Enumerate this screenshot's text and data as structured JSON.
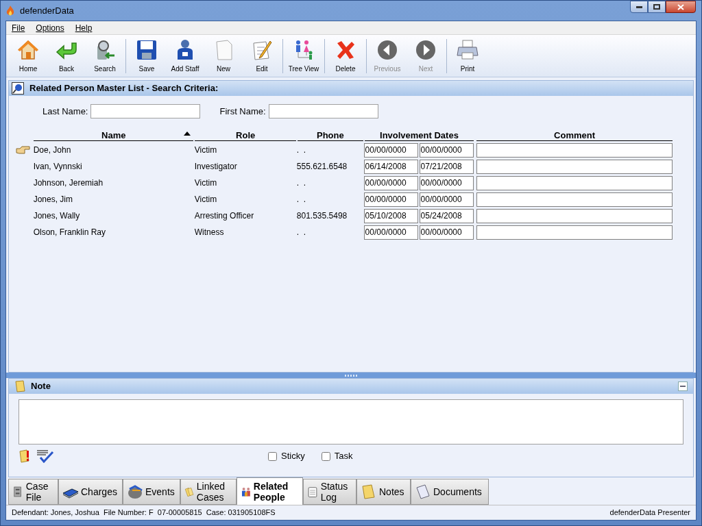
{
  "window": {
    "title": "defenderData"
  },
  "menu": [
    {
      "label": "File"
    },
    {
      "label": "Options"
    },
    {
      "label": "Help"
    }
  ],
  "toolbar": {
    "groups": [
      [
        {
          "label": "Home",
          "disabled": false
        },
        {
          "label": "Back",
          "disabled": false
        },
        {
          "label": "Search",
          "disabled": false
        }
      ],
      [
        {
          "label": "Save",
          "disabled": false
        },
        {
          "label": "Add Staff",
          "disabled": false
        },
        {
          "label": "New",
          "disabled": false
        },
        {
          "label": "Edit",
          "disabled": false
        }
      ],
      [
        {
          "label": "Tree View",
          "disabled": false
        }
      ],
      [
        {
          "label": "Delete",
          "disabled": false
        }
      ],
      [
        {
          "label": "Previous",
          "disabled": true
        },
        {
          "label": "Next",
          "disabled": true
        }
      ],
      [
        {
          "label": "Print",
          "disabled": false
        }
      ]
    ]
  },
  "search_panel": {
    "title": "Related Person Master List - Search Criteria:",
    "fields": [
      {
        "label": "Last Name:"
      },
      {
        "label": "First Name:"
      }
    ]
  },
  "table": {
    "columns": [
      {
        "label": "Name",
        "sorted": true
      },
      {
        "label": "Role",
        "sorted": false
      },
      {
        "label": "Phone",
        "sorted": false
      },
      {
        "label": "Involvement Dates",
        "sorted": false
      },
      {
        "label": "Comment",
        "sorted": false
      }
    ],
    "rows": [
      {
        "current": true,
        "name": "Doe, John",
        "role": "Victim",
        "phone": ".  .",
        "start": "00/00/0000",
        "end": "00/00/0000"
      },
      {
        "current": false,
        "name": "Ivan, Vynnski",
        "role": "Investigator",
        "phone": "555.621.6548",
        "start": "06/14/2008",
        "end": "07/21/2008"
      },
      {
        "current": false,
        "name": "Johnson, Jeremiah",
        "role": "Victim",
        "phone": ".  .",
        "start": "00/00/0000",
        "end": "00/00/0000"
      },
      {
        "current": false,
        "name": "Jones, Jim",
        "role": "Victim",
        "phone": ".  .",
        "start": "00/00/0000",
        "end": "00/00/0000"
      },
      {
        "current": false,
        "name": "Jones, Wally",
        "role": "Arresting Officer",
        "phone": "801.535.5498",
        "start": "05/10/2008",
        "end": "05/24/2008"
      },
      {
        "current": false,
        "name": "Olson, Franklin Ray",
        "role": "Witness",
        "phone": ".  .",
        "start": "00/00/0000",
        "end": "00/00/0000"
      }
    ]
  },
  "note_panel": {
    "title": "Note",
    "options": [
      {
        "label": "Sticky",
        "checked": false
      },
      {
        "label": "Task",
        "checked": false
      }
    ]
  },
  "tabs": [
    {
      "label": "Case File",
      "selected": false
    },
    {
      "label": "Charges",
      "selected": false
    },
    {
      "label": "Events",
      "selected": false
    },
    {
      "label": "Linked Cases",
      "selected": false
    },
    {
      "label": "Related People",
      "selected": true
    },
    {
      "label": "Status Log",
      "selected": false
    },
    {
      "label": "Notes",
      "selected": false
    },
    {
      "label": "Documents",
      "selected": false
    }
  ],
  "status_bar": {
    "left": "Defendant: Jones, Joshua  File Number: F  07-00005815  Case: 031905108FS",
    "right": "defenderData Presenter"
  }
}
